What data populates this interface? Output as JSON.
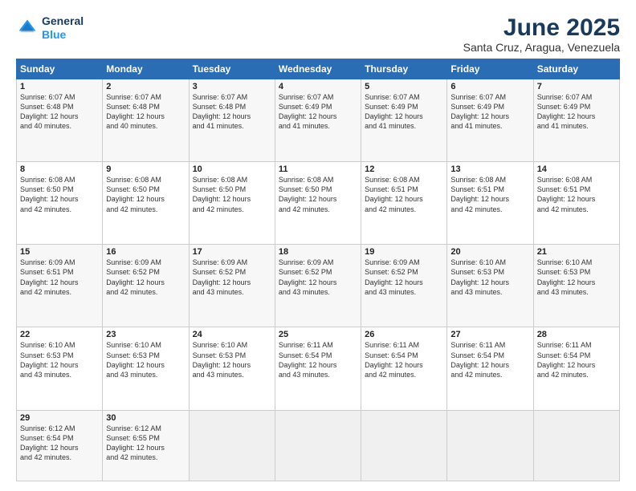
{
  "logo": {
    "line1": "General",
    "line2": "Blue"
  },
  "title": "June 2025",
  "subtitle": "Santa Cruz, Aragua, Venezuela",
  "weekdays": [
    "Sunday",
    "Monday",
    "Tuesday",
    "Wednesday",
    "Thursday",
    "Friday",
    "Saturday"
  ],
  "weeks": [
    [
      {
        "day": "1",
        "rise": "6:07 AM",
        "set": "6:48 PM",
        "hours": "12 hours",
        "mins": "40 minutes."
      },
      {
        "day": "2",
        "rise": "6:07 AM",
        "set": "6:48 PM",
        "hours": "12 hours",
        "mins": "40 minutes."
      },
      {
        "day": "3",
        "rise": "6:07 AM",
        "set": "6:48 PM",
        "hours": "12 hours",
        "mins": "41 minutes."
      },
      {
        "day": "4",
        "rise": "6:07 AM",
        "set": "6:49 PM",
        "hours": "12 hours",
        "mins": "41 minutes."
      },
      {
        "day": "5",
        "rise": "6:07 AM",
        "set": "6:49 PM",
        "hours": "12 hours",
        "mins": "41 minutes."
      },
      {
        "day": "6",
        "rise": "6:07 AM",
        "set": "6:49 PM",
        "hours": "12 hours",
        "mins": "41 minutes."
      },
      {
        "day": "7",
        "rise": "6:07 AM",
        "set": "6:49 PM",
        "hours": "12 hours",
        "mins": "41 minutes."
      }
    ],
    [
      {
        "day": "8",
        "rise": "6:08 AM",
        "set": "6:50 PM",
        "hours": "12 hours",
        "mins": "42 minutes."
      },
      {
        "day": "9",
        "rise": "6:08 AM",
        "set": "6:50 PM",
        "hours": "12 hours",
        "mins": "42 minutes."
      },
      {
        "day": "10",
        "rise": "6:08 AM",
        "set": "6:50 PM",
        "hours": "12 hours",
        "mins": "42 minutes."
      },
      {
        "day": "11",
        "rise": "6:08 AM",
        "set": "6:50 PM",
        "hours": "12 hours",
        "mins": "42 minutes."
      },
      {
        "day": "12",
        "rise": "6:08 AM",
        "set": "6:51 PM",
        "hours": "12 hours",
        "mins": "42 minutes."
      },
      {
        "day": "13",
        "rise": "6:08 AM",
        "set": "6:51 PM",
        "hours": "12 hours",
        "mins": "42 minutes."
      },
      {
        "day": "14",
        "rise": "6:08 AM",
        "set": "6:51 PM",
        "hours": "12 hours",
        "mins": "42 minutes."
      }
    ],
    [
      {
        "day": "15",
        "rise": "6:09 AM",
        "set": "6:51 PM",
        "hours": "12 hours",
        "mins": "42 minutes."
      },
      {
        "day": "16",
        "rise": "6:09 AM",
        "set": "6:52 PM",
        "hours": "12 hours",
        "mins": "42 minutes."
      },
      {
        "day": "17",
        "rise": "6:09 AM",
        "set": "6:52 PM",
        "hours": "12 hours",
        "mins": "43 minutes."
      },
      {
        "day": "18",
        "rise": "6:09 AM",
        "set": "6:52 PM",
        "hours": "12 hours",
        "mins": "43 minutes."
      },
      {
        "day": "19",
        "rise": "6:09 AM",
        "set": "6:52 PM",
        "hours": "12 hours",
        "mins": "43 minutes."
      },
      {
        "day": "20",
        "rise": "6:10 AM",
        "set": "6:53 PM",
        "hours": "12 hours",
        "mins": "43 minutes."
      },
      {
        "day": "21",
        "rise": "6:10 AM",
        "set": "6:53 PM",
        "hours": "12 hours",
        "mins": "43 minutes."
      }
    ],
    [
      {
        "day": "22",
        "rise": "6:10 AM",
        "set": "6:53 PM",
        "hours": "12 hours",
        "mins": "43 minutes."
      },
      {
        "day": "23",
        "rise": "6:10 AM",
        "set": "6:53 PM",
        "hours": "12 hours",
        "mins": "43 minutes."
      },
      {
        "day": "24",
        "rise": "6:10 AM",
        "set": "6:53 PM",
        "hours": "12 hours",
        "mins": "43 minutes."
      },
      {
        "day": "25",
        "rise": "6:11 AM",
        "set": "6:54 PM",
        "hours": "12 hours",
        "mins": "43 minutes."
      },
      {
        "day": "26",
        "rise": "6:11 AM",
        "set": "6:54 PM",
        "hours": "12 hours",
        "mins": "42 minutes."
      },
      {
        "day": "27",
        "rise": "6:11 AM",
        "set": "6:54 PM",
        "hours": "12 hours",
        "mins": "42 minutes."
      },
      {
        "day": "28",
        "rise": "6:11 AM",
        "set": "6:54 PM",
        "hours": "12 hours",
        "mins": "42 minutes."
      }
    ],
    [
      {
        "day": "29",
        "rise": "6:12 AM",
        "set": "6:54 PM",
        "hours": "12 hours",
        "mins": "42 minutes."
      },
      {
        "day": "30",
        "rise": "6:12 AM",
        "set": "6:55 PM",
        "hours": "12 hours",
        "mins": "42 minutes."
      },
      null,
      null,
      null,
      null,
      null
    ]
  ],
  "labels": {
    "sunrise": "Sunrise:",
    "sunset": "Sunset:",
    "daylight": "Daylight:"
  }
}
